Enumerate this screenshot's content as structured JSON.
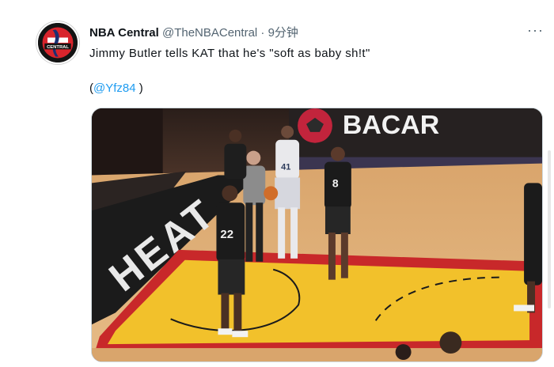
{
  "tweet": {
    "author_name": "NBA Central",
    "handle": "@TheNBACentral",
    "separator": "·",
    "time": "9分钟",
    "more_label": "···",
    "text": "Jimmy Butler tells KAT that he's \"soft as baby sh!t\"",
    "mention_open": "(",
    "mention": "@Yfz84",
    "mention_close": ")",
    "avatar_logo_text": "CENTRAL",
    "avatar_icon": "nba-central-logo"
  },
  "video": {
    "court_text": "HEAT",
    "banner_text": "BACAR",
    "jersey_numbers": [
      "41",
      "8",
      "22"
    ],
    "colors": {
      "court_wood": "#e0b27c",
      "paint_yellow": "#f2c12b",
      "paint_red": "#c8282a",
      "dark": "#1b1b1b",
      "banner_red": "#c2243c"
    }
  }
}
